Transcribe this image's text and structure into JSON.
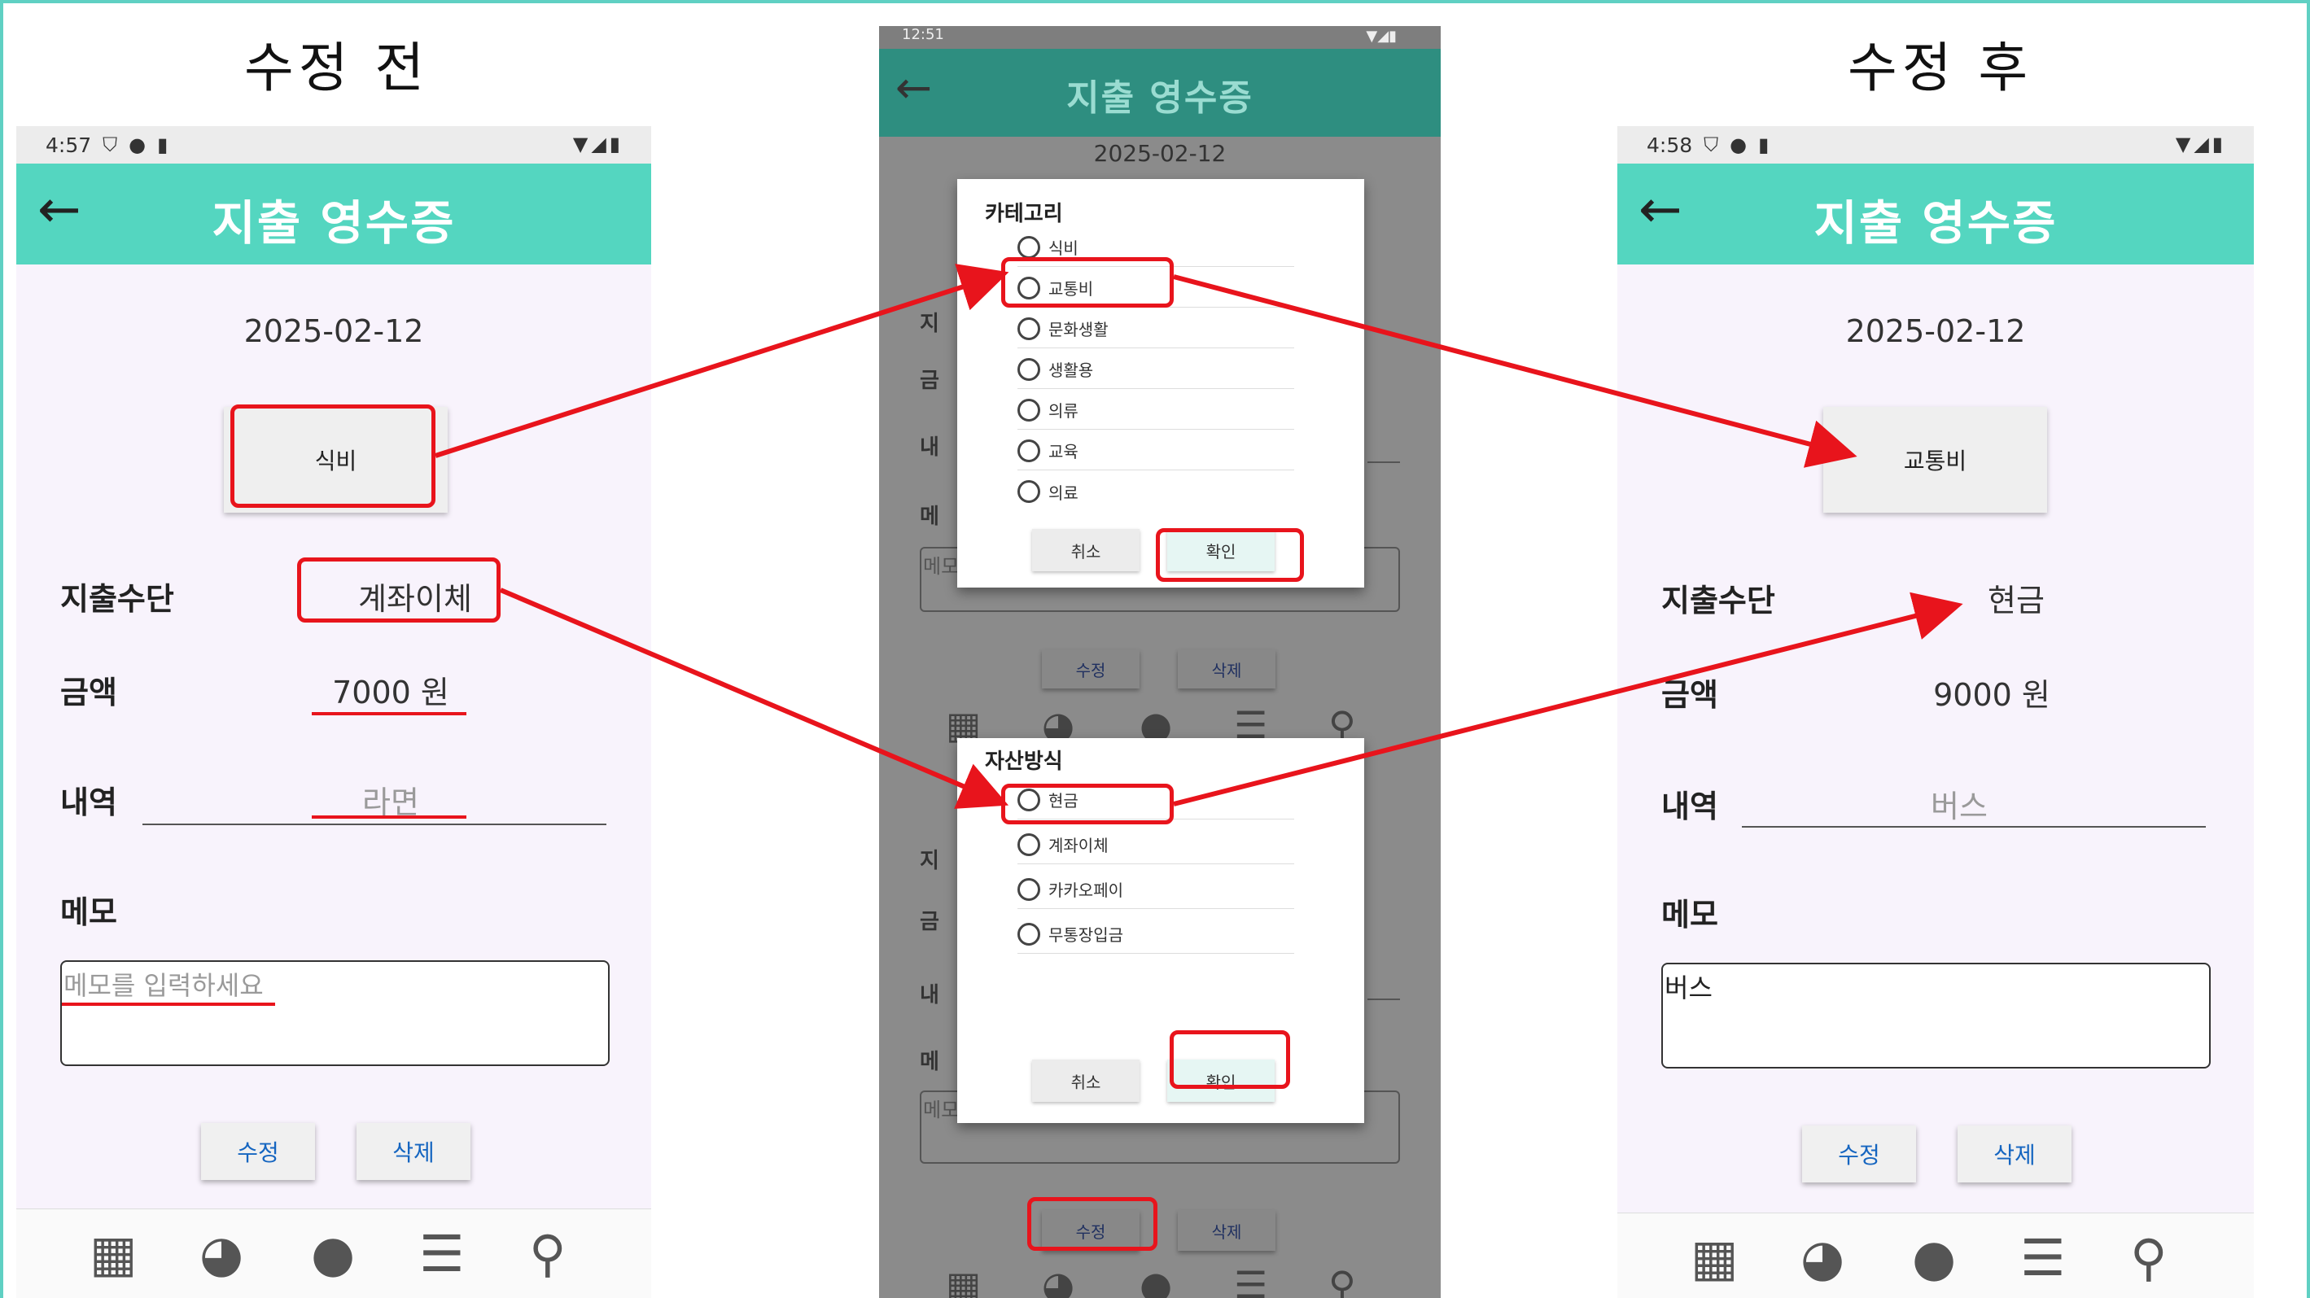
{
  "captions": {
    "before": "수정 전",
    "after": "수정 후"
  },
  "before": {
    "status_time": "4:57",
    "title": "지출 영수증",
    "back_icon": "←",
    "date": "2025-02-12",
    "category": "식비",
    "payment_label": "지출수단",
    "payment_value": "계좌이체",
    "amount_label": "금액",
    "amount_value": "7000 원",
    "detail_label": "내역",
    "detail_value": "라면",
    "memo_label": "메모",
    "memo_placeholder": "메모를 입력하세요",
    "edit_button": "수정",
    "delete_button": "삭제"
  },
  "middle": {
    "status_time": "12:51",
    "title": "지출 영수증",
    "back_icon": "←",
    "date": "2025-02-12",
    "category_dialog": {
      "title": "카테고리",
      "options": [
        "식비",
        "교통비",
        "문화생활",
        "생활용",
        "의류",
        "교육",
        "의료"
      ],
      "cancel": "취소",
      "confirm": "확인"
    },
    "payment_dialog": {
      "title": "자산방식",
      "options": [
        "현금",
        "계좌이체",
        "카카오페이",
        "무통장입금"
      ],
      "cancel": "취소",
      "confirm": "확인"
    },
    "bg_labels_1": [
      "지",
      "금",
      "내",
      "메"
    ],
    "bg_labels_2": [
      "지",
      "금",
      "내",
      "메"
    ],
    "memo_peek_1": "메모",
    "memo_placeholder": "메모를 입력하세요",
    "edit_button": "수정",
    "delete_button": "삭제"
  },
  "after": {
    "status_time": "4:58",
    "title": "지출 영수증",
    "back_icon": "←",
    "date": "2025-02-12",
    "category": "교통비",
    "payment_label": "지출수단",
    "payment_value": "현금",
    "amount_label": "금액",
    "amount_value": "9000 원",
    "detail_label": "내역",
    "detail_value": "버스",
    "memo_label": "메모",
    "memo_value": "버스",
    "edit_button": "수정",
    "delete_button": "삭제"
  },
  "nav_icons": [
    "calendar-icon",
    "pie-chart-icon",
    "person-icon",
    "list-icon",
    "search-icon"
  ],
  "colors": {
    "accent": "#54d6c0",
    "highlight": "#e8141c",
    "button_text": "#1565c0"
  }
}
